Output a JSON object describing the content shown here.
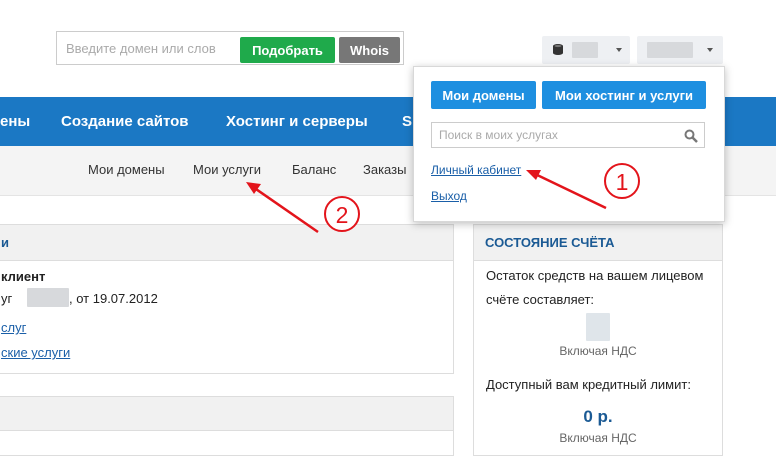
{
  "header": {
    "search_placeholder": "Введите домен или слов",
    "pick_button": "Подобрать",
    "whois_button": "Whois"
  },
  "nav": {
    "items": [
      "ены",
      "Создание сайтов",
      "Хостинг и серверы",
      "S"
    ]
  },
  "subnav": {
    "items": [
      "Мои домены",
      "Мои услуги",
      "Баланс",
      "Заказы"
    ]
  },
  "client_panel": {
    "title_fragment": "и",
    "client_label": "клиент",
    "contract_prefix": "уг",
    "contract_suffix": ", от 19.07.2012",
    "link1": "слуг",
    "link2": "ские услуги"
  },
  "account_panel": {
    "title": "СОСТОЯНИЕ СЧЁТА",
    "balance_text_line1": "Остаток средств на вашем лицевом",
    "balance_text_line2": "счёте составляет:",
    "vat_label_1": "Включая НДС",
    "credit_label": "Доступный вам кредитный лимит:",
    "credit_value": "0 р.",
    "vat_label_2": "Включая НДС"
  },
  "dropdown": {
    "my_domains_button": "Мои домены",
    "my_hosting_button": "Мои хостинг и услуги",
    "search_placeholder": "Поиск в моих услугах",
    "cabinet_link": "Личный кабинет",
    "logout_link": "Выход"
  },
  "annotations": {
    "marker1": "1",
    "marker2": "2",
    "color": "#e3141b"
  },
  "colors": {
    "nav_blue": "#1b78c4",
    "button_blue": "#1e8fe0",
    "green": "#1faa4b",
    "gray_button": "#777777",
    "link_blue": "#1a5fa8",
    "heading_blue": "#1b5a94"
  }
}
